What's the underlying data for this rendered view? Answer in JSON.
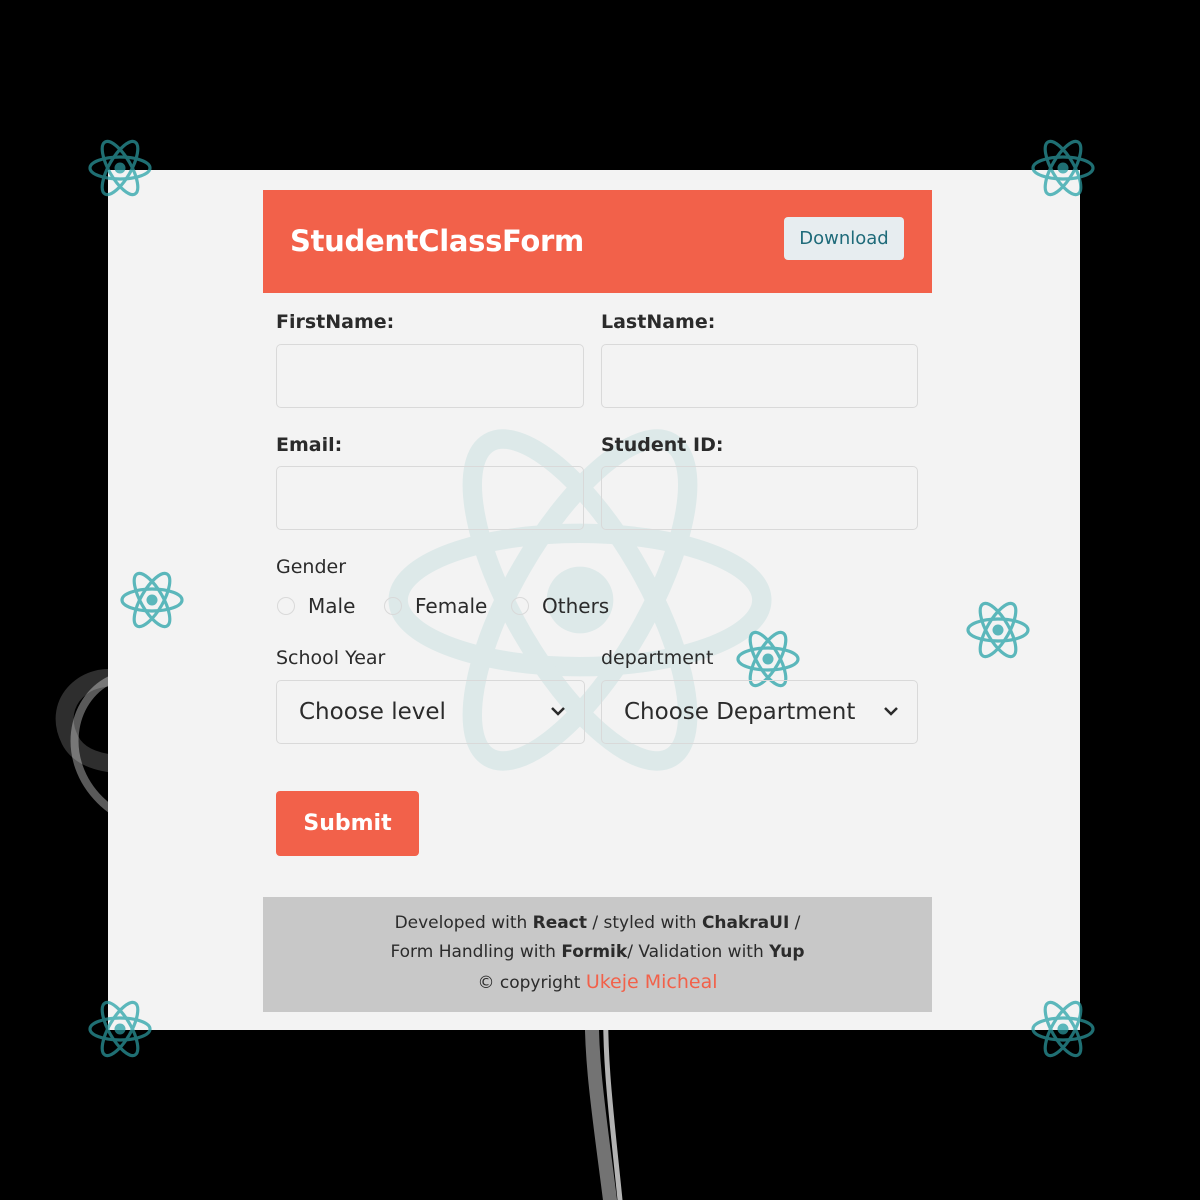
{
  "header": {
    "title": "StudentClassForm",
    "download_label": "Download"
  },
  "form": {
    "first_name_label": "FirstName:",
    "last_name_label": "LastName:",
    "email_label": "Email:",
    "student_id_label": "Student ID:",
    "gender_label": "Gender",
    "gender_options": [
      "Male",
      "Female",
      "Others"
    ],
    "school_year_label": "School Year",
    "school_year_selected": "Choose level",
    "department_label": "department",
    "department_selected": "Choose Department",
    "submit_label": "Submit"
  },
  "footer": {
    "line1": {
      "t1": "Developed with ",
      "b1": "React",
      "t2": " / styled with ",
      "b2": "ChakraUI",
      "t3": " /"
    },
    "line2": {
      "t1": "Form Handling with ",
      "b1": "Formik",
      "t2": "/ Validation with ",
      "b2": "Yup"
    },
    "line3": {
      "prefix": "© copyright ",
      "author": "Ukeje Micheal"
    }
  },
  "colors": {
    "accent": "#f2614a",
    "atom": "#5bb7bb",
    "card": "#f3f3f3",
    "footer": "#c8c8c8"
  }
}
